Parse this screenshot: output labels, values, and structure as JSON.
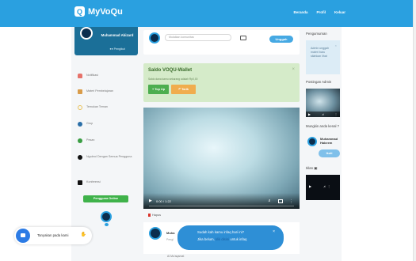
{
  "app": {
    "name": "MyVoQu",
    "logo_letter": "Q"
  },
  "topnav": {
    "items": [
      "Beranda",
      "Profil",
      "Keluar"
    ]
  },
  "profile": {
    "name": "Muhammad Abizard",
    "role_line": "Pengikut"
  },
  "sidebar": {
    "items": [
      {
        "label": "Notifikasi",
        "icon": "bell-icon",
        "color": "#e6726a"
      },
      {
        "label": "Materi Pembelajaran",
        "icon": "book-icon",
        "color": "#d99c4a"
      },
      {
        "label": "Temukan Teman",
        "icon": "search-icon",
        "color": "#e9c25a"
      },
      {
        "label": "Grup",
        "icon": "group-icon",
        "color": "#2b6fa8"
      },
      {
        "label": "Pesan",
        "icon": "chat-icon",
        "color": "#3a9e43"
      },
      {
        "label": "Ngobrol Dengan Semua Pengguna",
        "icon": "chat-bubbles-icon",
        "color": "#111111"
      },
      {
        "label": "Konferensi",
        "icon": "camera-icon",
        "color": "#111111"
      }
    ],
    "online_button": "Pengguna Online"
  },
  "post": {
    "placeholder": "Mulaikan komunitas",
    "submit": "Unggah"
  },
  "wallet": {
    "title": "Saldo VOQU-Wallet",
    "subtitle": "Saldo dana kamu sekarang adalah Rp0,00",
    "btn_topup": "Top Up",
    "btn_withdraw": "Tarik"
  },
  "video": {
    "time": "0:00 / 1:22"
  },
  "post_actions": {
    "delete": "Hapus"
  },
  "comment": {
    "name": "Muha",
    "sub": "Pengi",
    "footer": "Al Mu'aqamat"
  },
  "toast": {
    "line1": "Sudah kah kamu infaq hari ini?",
    "line2_pre": "Jika belum,",
    "line2_link": "klik disini",
    "line2_post": "untuk infaq"
  },
  "right": {
    "announcement_title": "Pengumuman",
    "announcement_text": "Admin unggah materi baru silahkan lihat",
    "admin_posts_title": "Postingan Admin",
    "suggest_title": "Mungkin anda kenal ?",
    "suggest_name": "Muhammad Hakeem",
    "suggest_btn": "Ikuti",
    "videos_title": "Iklan"
  },
  "chat": {
    "text": "Tanyakan pada kami"
  }
}
